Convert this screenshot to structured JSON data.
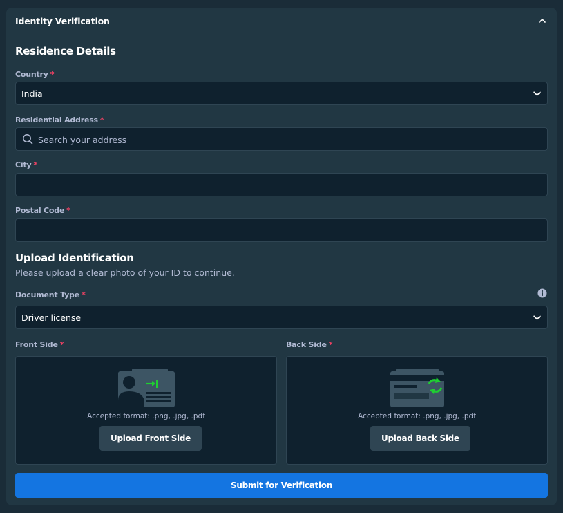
{
  "panel": {
    "title": "Identity Verification",
    "collapse_icon": "chevron-up-icon"
  },
  "residence": {
    "section_title": "Residence Details",
    "country": {
      "label": "Country",
      "required": "*",
      "value": "India",
      "icon": "chevron-down-icon"
    },
    "address": {
      "label": "Residential Address",
      "required": "*",
      "placeholder": "Search your address",
      "value": "",
      "icon": "search-icon"
    },
    "city": {
      "label": "City",
      "required": "*",
      "value": ""
    },
    "postal_code": {
      "label": "Postal Code",
      "required": "*",
      "value": ""
    }
  },
  "identification": {
    "section_title": "Upload Identification",
    "subtitle": "Please upload a clear photo of your ID to continue.",
    "document_type": {
      "label": "Document Type",
      "required": "*",
      "value": "Driver license",
      "info_icon": "info-icon",
      "icon": "chevron-down-icon"
    },
    "front": {
      "label": "Front Side",
      "required": "*",
      "formats": "Accepted format: .png, .jpg, .pdf",
      "button": "Upload Front Side",
      "icon": "id-card-front-icon"
    },
    "back": {
      "label": "Back Side",
      "required": "*",
      "formats": "Accepted format: .png, .jpg, .pdf",
      "button": "Upload Back Side",
      "icon": "id-card-back-icon"
    }
  },
  "submit_label": "Submit for Verification",
  "colors": {
    "background": "#1a2c38",
    "panel": "#213743",
    "input": "#0f212e",
    "border": "#2f4553",
    "label": "#b1bad3",
    "required": "#ed4163",
    "primary": "#1475e1",
    "accent_green": "#1fce32"
  }
}
